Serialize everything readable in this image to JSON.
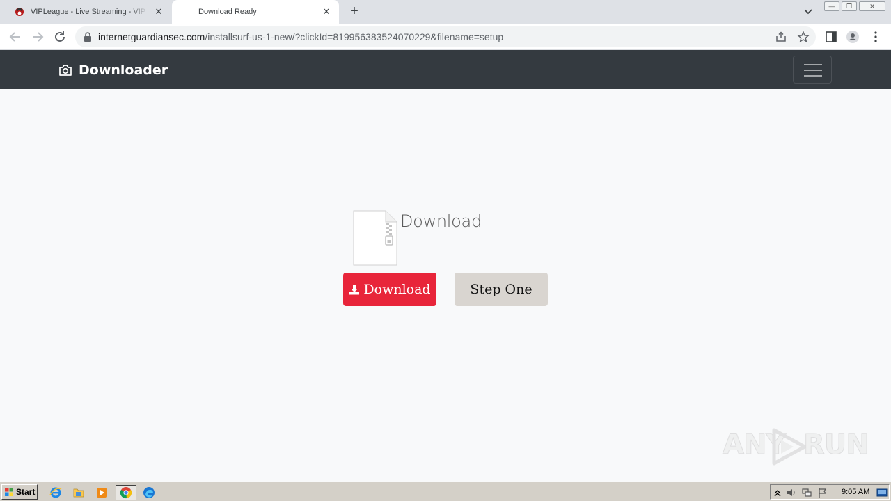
{
  "browser": {
    "tabs": [
      {
        "title": "VIPLeague - Live Streaming - VIP Sports",
        "active": false,
        "close": "✕"
      },
      {
        "title": "Download Ready",
        "active": true,
        "close": "✕"
      }
    ],
    "new_tab": "+",
    "url_host": "internetguardiansec.com",
    "url_path": "/installsurf-us-1-new/?clickId=819956383524070229&filename=setup"
  },
  "site": {
    "brand": "Downloader",
    "file_heading": "Download",
    "download_button": "Download",
    "step_button": "Step One",
    "colors": {
      "navbar": "#343a40",
      "download_button": "#e8253a",
      "step_button": "#d9d5d0"
    }
  },
  "watermark": {
    "left": "ANY",
    "right": "RUN"
  },
  "taskbar": {
    "start_label": "Start",
    "apps": [
      "ie-icon",
      "explorer-icon",
      "media-player-icon",
      "chrome-icon",
      "edge-icon"
    ],
    "clock": "9:05 AM"
  }
}
